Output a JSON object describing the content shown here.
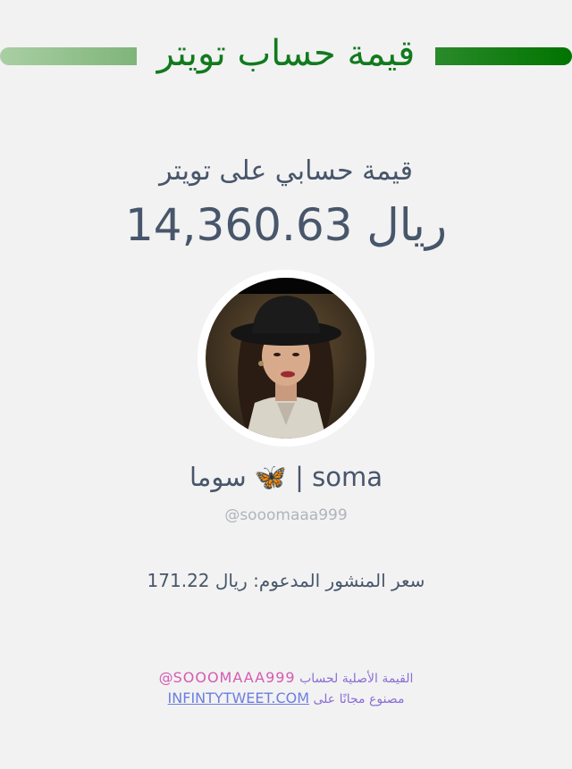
{
  "header": {
    "title": "قيمة حساب تويتر"
  },
  "account_value": {
    "label": "قيمة حسابي على تويتر",
    "amount": "ريال 14,360.63"
  },
  "profile": {
    "display_name": "soma | 🦋 سوما",
    "handle": "@sooomaaa999"
  },
  "promoted_post": {
    "text": "سعر المنشور المدعوم: ريال 171.22"
  },
  "footer": {
    "original_value_text": "القيمة الأصلية لحساب",
    "handle": "@sooomaaa999",
    "made_free_text": "مصنوع مجانًا على",
    "site": "infintytweet.com"
  },
  "colors": {
    "title": "#127a1e",
    "text": "#48566b",
    "handle": "#b0b4ba",
    "footer_purple": "#8a6fd6",
    "footer_pink": "#d45bb3",
    "footer_link": "#6c7ee0",
    "background": "#f2f2f2"
  }
}
